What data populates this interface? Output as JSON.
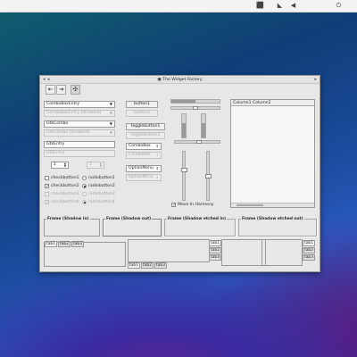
{
  "window": {
    "title": "The Widget Factory"
  },
  "toolbar": [
    {
      "icon": "go-first-icon"
    },
    {
      "icon": "go-last-icon"
    },
    {
      "icon": "view-switch-icon"
    }
  ],
  "left": {
    "combos": [
      {
        "value": "ComboBoxEntry",
        "disabled": false
      },
      {
        "value": "ComboBoxEntry (disabled)",
        "disabled": true
      },
      {
        "value": "GtkCombo",
        "disabled": false
      },
      {
        "value": "GtkCombo (disabled)",
        "disabled": true
      }
    ],
    "entries": [
      {
        "value": "GtkEntry",
        "disabled": false
      },
      {
        "value": "GtkEntry",
        "disabled": true
      }
    ],
    "spins": [
      {
        "value": "1",
        "disabled": false
      },
      {
        "value": "1",
        "disabled": true
      }
    ],
    "checks": [
      {
        "label": "checkbutton1",
        "checked": false,
        "disabled": false
      },
      {
        "label": "checkbutton2",
        "checked": true,
        "disabled": false
      },
      {
        "label": "checkbutton3",
        "checked": false,
        "disabled": true
      },
      {
        "label": "checkbutton4",
        "checked": true,
        "disabled": true
      }
    ],
    "radios": [
      {
        "label": "radiobutton1",
        "on": false,
        "disabled": false
      },
      {
        "label": "radiobutton2",
        "on": true,
        "disabled": false
      },
      {
        "label": "radiobutton3",
        "on": false,
        "disabled": true
      },
      {
        "label": "radiobutton4",
        "on": true,
        "disabled": true
      }
    ]
  },
  "mid": {
    "buttons": [
      {
        "label": "button1",
        "disabled": false
      },
      {
        "label": "button2",
        "disabled": true
      },
      {
        "label": "togglebutton1",
        "disabled": false
      },
      {
        "label": "togglebutton2",
        "disabled": true
      }
    ],
    "combos": [
      {
        "value": "ComboBox",
        "disabled": false
      },
      {
        "value": "ComboBox",
        "disabled": true
      },
      {
        "value": "OptionMenu",
        "disabled": false
      },
      {
        "value": "OptionMenu",
        "disabled": true
      }
    ]
  },
  "sliders": {
    "move_label": "Move In Harmony",
    "move_checked": true,
    "hprogress": 0.5,
    "hscale": 0.48,
    "vprogress": 0.62,
    "vscale1": 0.35,
    "vscale2": 0.5
  },
  "tree": {
    "columns": [
      "Column1",
      "Column2"
    ]
  },
  "frames": [
    {
      "label": "Frame (Shadow in)"
    },
    {
      "label": "Frame (Shadow out)"
    },
    {
      "label": "Frame (Shadow etched in)"
    },
    {
      "label": "Frame (Shadow etched out)"
    }
  ],
  "notebooks": {
    "tabs": [
      "tab1",
      "tab2",
      "tab3"
    ]
  }
}
